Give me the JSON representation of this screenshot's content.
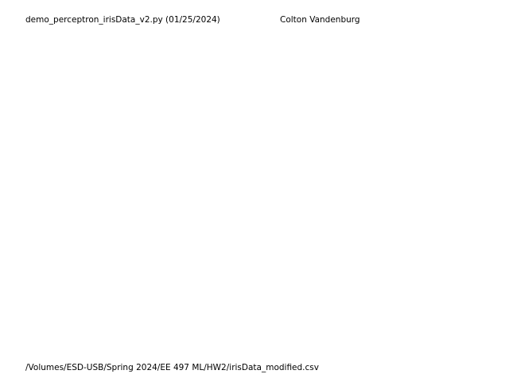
{
  "header": {
    "script_label": "demo_perceptron_irisData_v2.py (01/25/2024)",
    "author": "Colton Vandenburg"
  },
  "footer": {
    "file_path": "/Volumes/ESD-USB/Spring 2024/EE 497 ML/HW2/irisData_modified.csv"
  }
}
